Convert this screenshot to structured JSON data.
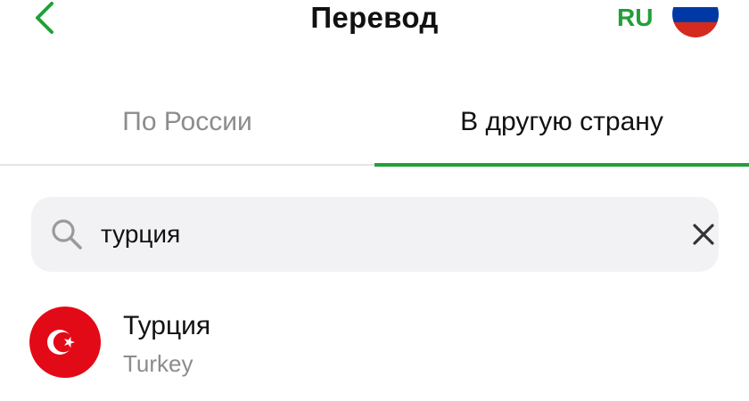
{
  "header": {
    "title": "Перевод",
    "back_icon": "chevron-left-icon",
    "language_code": "RU",
    "language_flag": "russia-flag-icon"
  },
  "tabs": [
    {
      "label": "По России",
      "active": false
    },
    {
      "label": "В другую страну",
      "active": true
    }
  ],
  "search": {
    "value": "турция",
    "placeholder": "",
    "search_icon": "search-icon",
    "clear_icon": "close-icon"
  },
  "results": [
    {
      "name": "Турция",
      "name_en": "Turkey",
      "flag_icon": "turkey-flag-icon"
    }
  ],
  "colors": {
    "accent": "#21a038",
    "text_primary": "#111111",
    "text_secondary": "#8c8c8c",
    "search_background": "#f2f2f4",
    "turkey_red": "#e30a17"
  }
}
